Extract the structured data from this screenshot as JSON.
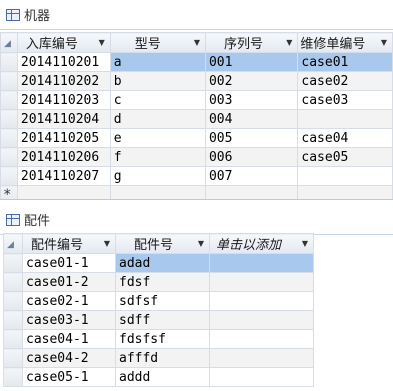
{
  "machine_table": {
    "title": "机器",
    "columns": [
      "入库编号",
      "型号",
      "序列号",
      "维修单编号"
    ],
    "rows": [
      [
        "2014110201",
        "a",
        "001",
        "case01"
      ],
      [
        "2014110202",
        "b",
        "002",
        "case02"
      ],
      [
        "2014110203",
        "c",
        "003",
        "case03"
      ],
      [
        "2014110204",
        "d",
        "004",
        ""
      ],
      [
        "2014110205",
        "e",
        "005",
        "case04"
      ],
      [
        "2014110206",
        "f",
        "006",
        "case05"
      ],
      [
        "2014110207",
        "g",
        "007",
        ""
      ]
    ],
    "new_row_marker": "*"
  },
  "parts_table": {
    "title": "配件",
    "columns": [
      "配件编号",
      "配件号",
      "单击以添加"
    ],
    "rows": [
      [
        "case01-1",
        "adad"
      ],
      [
        "case01-2",
        "fdsf"
      ],
      [
        "case02-1",
        "sdfsf"
      ],
      [
        "case03-1",
        "sdff"
      ],
      [
        "case04-1",
        "fdsfsf"
      ],
      [
        "case04-2",
        "afffd"
      ],
      [
        "case05-1",
        "addd"
      ]
    ]
  },
  "icons": {
    "sort_arrow": "dropdown-arrow-icon",
    "table_icon": "table-icon"
  }
}
